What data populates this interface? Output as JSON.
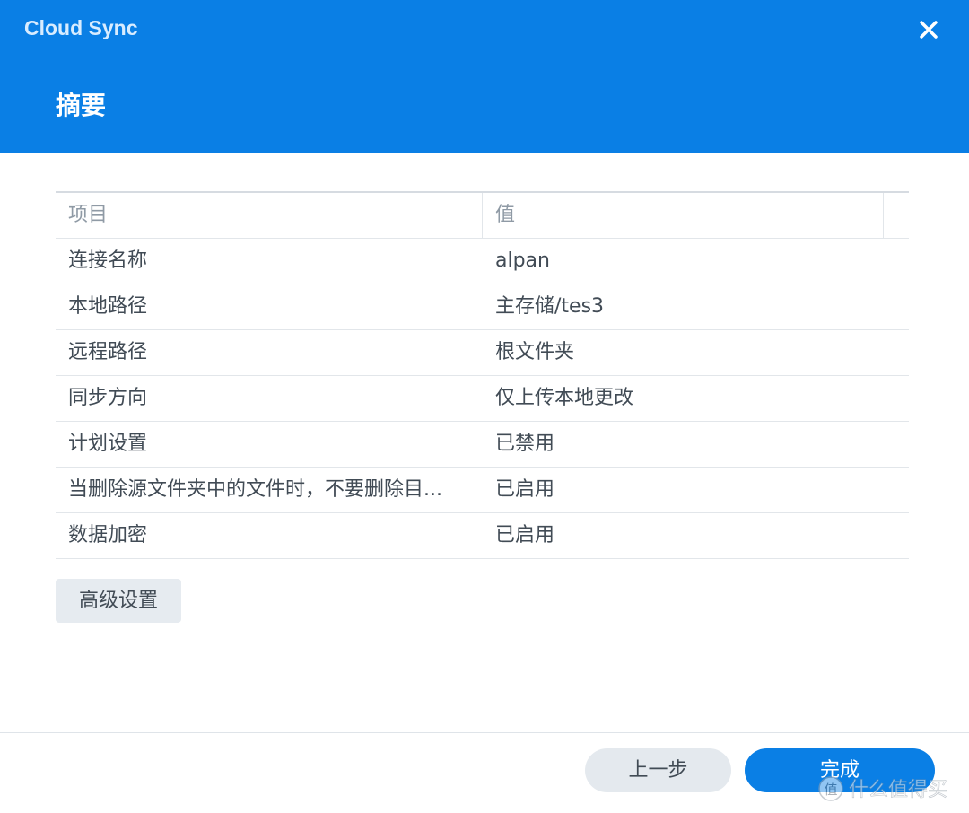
{
  "window": {
    "app_title": "Cloud Sync",
    "page_title": "摘要"
  },
  "summary_table": {
    "headers": [
      "项目",
      "值"
    ],
    "rows": [
      {
        "item": "连接名称",
        "value": "alpan"
      },
      {
        "item": "本地路径",
        "value": "主存储/tes3"
      },
      {
        "item": "远程路径",
        "value": "根文件夹"
      },
      {
        "item": "同步方向",
        "value": "仅上传本地更改"
      },
      {
        "item": "计划设置",
        "value": "已禁用"
      },
      {
        "item": "当删除源文件夹中的文件时，不要删除目...",
        "value": "已启用"
      },
      {
        "item": "数据加密",
        "value": "已启用"
      }
    ]
  },
  "buttons": {
    "advanced": "高级设置",
    "previous": "上一步",
    "finish": "完成"
  },
  "watermark": {
    "text": "值 什么值得买"
  },
  "colors": {
    "accent": "#0a7fe5",
    "button_gray": "#e6ebf0"
  },
  "icons": {
    "close": "close-icon"
  }
}
